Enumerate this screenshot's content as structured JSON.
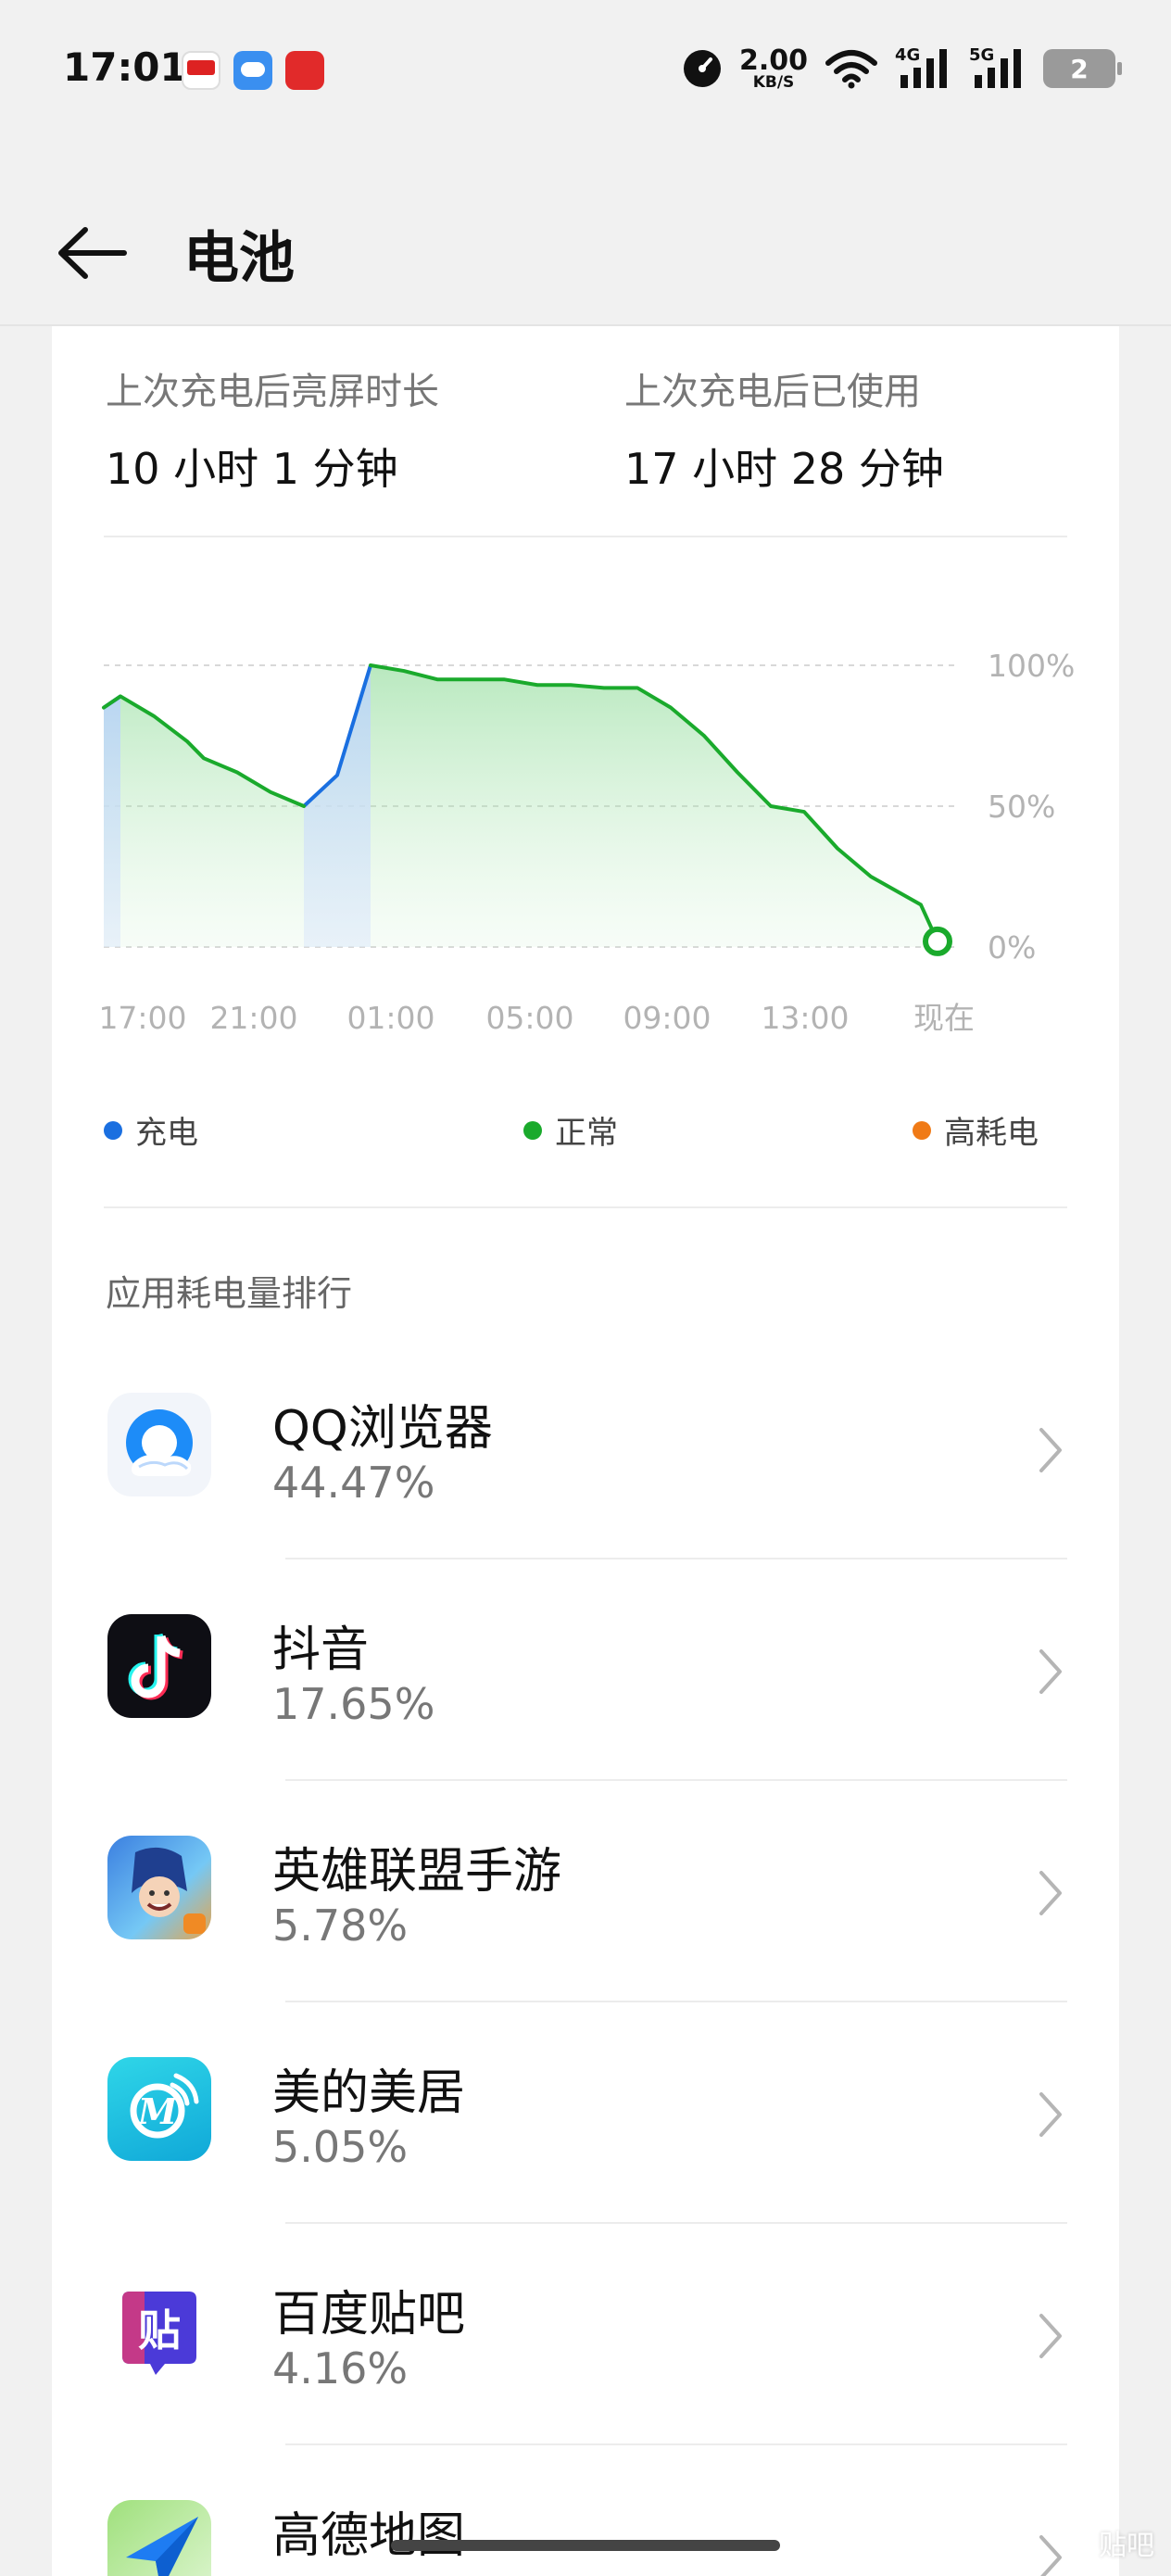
{
  "status_bar": {
    "time": "17:01",
    "net_speed": "2.00",
    "net_unit": "KB/S",
    "net_4g": "4G",
    "net_5g": "5G",
    "battery": "2"
  },
  "header": {
    "title": "电池"
  },
  "stats": {
    "screen_on_label": "上次充电后亮屏时长",
    "screen_on_value": "10 小时 1 分钟",
    "used_label": "上次充电后已使用",
    "used_value": "17 小时 28 分钟"
  },
  "chart_data": {
    "type": "area",
    "x_ticks": [
      "17:00",
      "21:00",
      "01:00",
      "05:00",
      "09:00",
      "13:00",
      "现在"
    ],
    "y_ticks": [
      "100%",
      "50%",
      "0%"
    ],
    "ylim": [
      0,
      100
    ],
    "series": [
      {
        "name": "正常",
        "color": "#1aaa2c",
        "x_hours": [
          0,
          0.5,
          1.5,
          2.5,
          3,
          4,
          5,
          6,
          7,
          8,
          9,
          10,
          11,
          12,
          13,
          14,
          15,
          15.5,
          16,
          17,
          18,
          19,
          20,
          21,
          22,
          23,
          24.5,
          25
        ],
        "values": [
          85,
          89,
          82,
          73,
          67,
          62,
          55,
          50,
          61,
          100,
          98,
          95,
          95,
          95,
          93,
          93,
          92,
          92,
          92,
          85,
          75,
          62,
          50,
          48,
          35,
          25,
          15,
          2
        ]
      }
    ],
    "charging_segments": [
      {
        "start_hour": 0,
        "end_hour": 0.5
      },
      {
        "start_hour": 6,
        "end_hour": 8
      }
    ],
    "legend": [
      {
        "label": "充电",
        "color": "#1a6fe0"
      },
      {
        "label": "正常",
        "color": "#1aaa2c"
      },
      {
        "label": "高耗电",
        "color": "#f07a16"
      }
    ]
  },
  "ranking_title": "应用耗电量排行",
  "apps": [
    {
      "name": "QQ浏览器",
      "percent": "44.47%",
      "icon": "qq-browser-icon"
    },
    {
      "name": "抖音",
      "percent": "17.65%",
      "icon": "douyin-icon"
    },
    {
      "name": "英雄联盟手游",
      "percent": "5.78%",
      "icon": "league-of-legends-icon"
    },
    {
      "name": "美的美居",
      "percent": "5.05%",
      "icon": "midea-icon"
    },
    {
      "name": "百度贴吧",
      "percent": "4.16%",
      "icon": "baidu-tieba-icon"
    },
    {
      "name": "高德地图",
      "percent": "",
      "icon": "amap-icon"
    }
  ],
  "watermark": "贴吧"
}
